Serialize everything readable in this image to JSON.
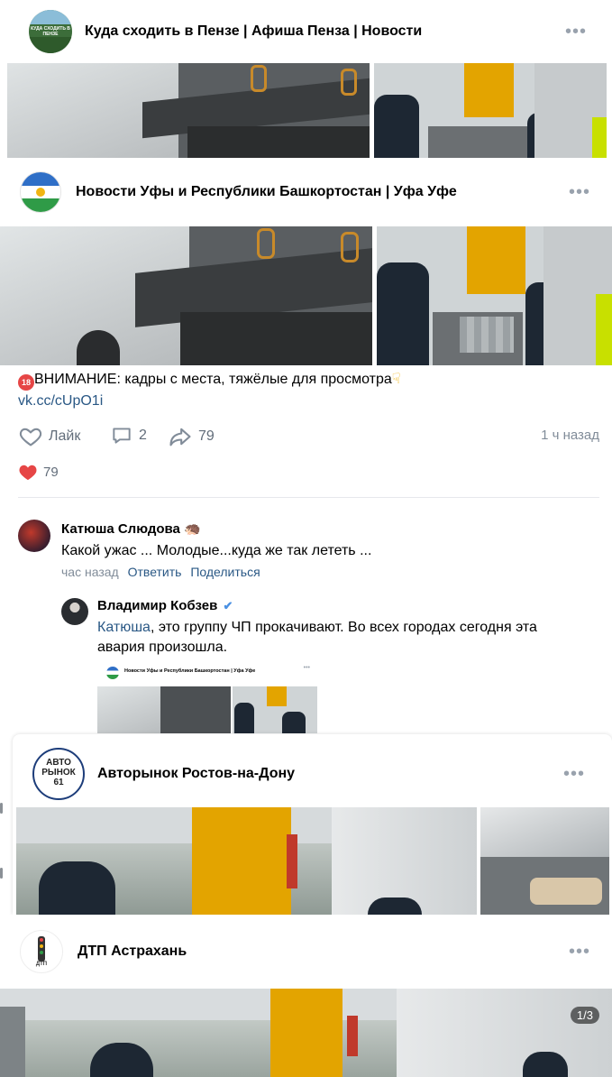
{
  "posts": [
    {
      "group_name": "Куда сходить в Пензе | Афиша Пенза | Новости",
      "avatar_text": "КУДА СХОДИТЬ В ПЕНЗЕ",
      "more": "•••"
    },
    {
      "group_name": "Новости Уфы и Республики Башкортостан | Уфа Уфе",
      "more": "•••",
      "text_badge": "18",
      "text": "ВНИМАНИЕ: кадры с места, тяжёлые для просмотра",
      "link": "vk.cc/cUpO1i",
      "actions": {
        "like_label": "Лайк",
        "comments": "2",
        "shares": "79",
        "time": "1 ч назад"
      },
      "reactions_count": "79"
    },
    {
      "group_name": "Авторынок Ростов-на-Дону",
      "avatar_text": "АВТО РЫНОК 61",
      "more": "•••"
    },
    {
      "group_name": "ДТП Астрахань",
      "avatar_text": "ДТП",
      "more": "•••",
      "photo_counter": "1/3"
    }
  ],
  "comments": [
    {
      "author": "Катюша Слюдова",
      "author_emoji": "🦔",
      "text": "Какой ужас ... Молодые...куда же так лететь ...",
      "meta": {
        "time": "час назад",
        "reply": "Ответить",
        "share": "Поделиться"
      },
      "reply": {
        "author": "Владимир Кобзев",
        "verified": "✔",
        "mention": "Катюша",
        "text_line1": ", это группу ЧП прокачивают. Во всех городах сегодня эта",
        "text_line2": "авария произошла.",
        "attachment_title": "Новости Уфы и Республики Башкортостан | Уфа Уфе"
      }
    }
  ],
  "colors": {
    "link": "#2a5885",
    "muted": "#818c99",
    "heart": "#e64646",
    "crane": "#e3a400",
    "police": "#1d2733"
  }
}
